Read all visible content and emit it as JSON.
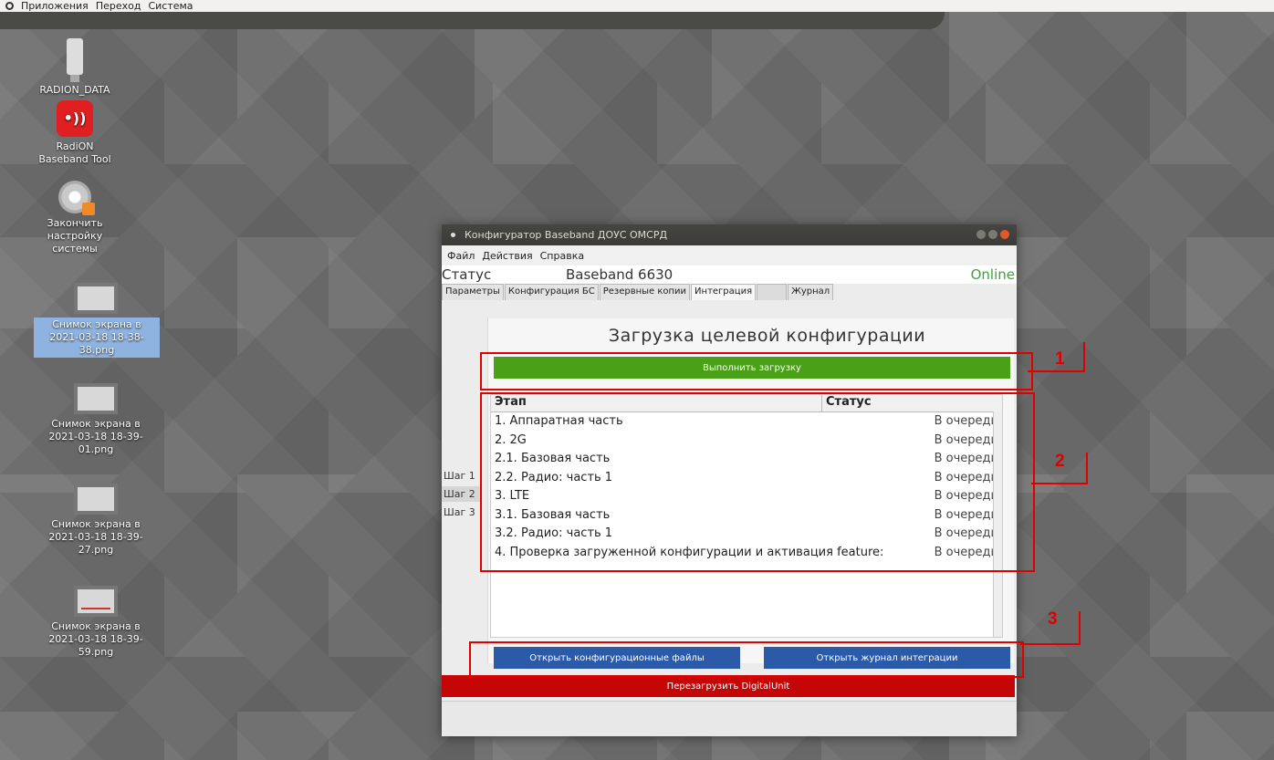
{
  "topbar": {
    "menu": [
      "Приложения",
      "Переход",
      "Система"
    ]
  },
  "desktop_icons": [
    {
      "label": "RADION_DATA",
      "icon": "usb-drive-icon"
    },
    {
      "label": "RadiON Baseband Tool",
      "icon": "radion-app-icon",
      "glyph": "•))"
    },
    {
      "label": "Закончить настройку системы",
      "icon": "settings-gear-icon"
    },
    {
      "label": "Снимок экрана в 2021-03-18 18-38-38.png",
      "icon": "image-file-icon",
      "selected": true
    },
    {
      "label": "Снимок экрана в 2021-03-18 18-39-01.png",
      "icon": "image-file-icon"
    },
    {
      "label": "Снимок экрана в 2021-03-18 18-39-27.png",
      "icon": "image-file-icon"
    },
    {
      "label": "Снимок экрана в 2021-03-18 18-39-59.png",
      "icon": "image-file-icon"
    }
  ],
  "window": {
    "title": "Конфигуратор Baseband ДОУС ОМСРД",
    "menu": [
      "Файл",
      "Действия",
      "Справка"
    ],
    "status_label": "Статус",
    "device": "Baseband 6630",
    "state": "Online",
    "tabs": [
      "Параметры",
      "Конфигурация БС",
      "Резервные копии",
      "Интеграция",
      "",
      "Журнал"
    ],
    "active_tab": "Интеграция",
    "steps": [
      "Шаг 1",
      "Шаг 2",
      "Шаг 3"
    ],
    "heading": "Загрузка целевой конфигурации",
    "run_button": "Выполнить загрузку",
    "table": {
      "headers": [
        "Этап",
        "Статус"
      ],
      "rows": [
        {
          "stage": "1. Аппаратная часть",
          "status": "В очереди"
        },
        {
          "stage": "2. 2G",
          "status": "В очереди"
        },
        {
          "stage": "2.1. Базовая часть",
          "status": "В очереди"
        },
        {
          "stage": "2.2. Радио: часть 1",
          "status": "В очереди"
        },
        {
          "stage": "3. LTE",
          "status": "В очереди"
        },
        {
          "stage": "3.1. Базовая часть",
          "status": "В очереди"
        },
        {
          "stage": "3.2. Радио: часть 1",
          "status": "В очереди"
        },
        {
          "stage": "4. Проверка загруженной конфигурации и активация feature:",
          "status": "В очереди"
        }
      ]
    },
    "open_config_button": "Открыть конфигурационные файлы",
    "open_log_button": "Открыть журнал интеграции",
    "reboot_button": "Перезагрузить DigitalUnit"
  },
  "annotations": [
    "1",
    "2",
    "3"
  ],
  "colors": {
    "run_button": "#4aa017",
    "action_buttons": "#2b5aa8",
    "reboot_button": "#c40606",
    "annotation": "#e00000",
    "online": "#3aa43a"
  }
}
